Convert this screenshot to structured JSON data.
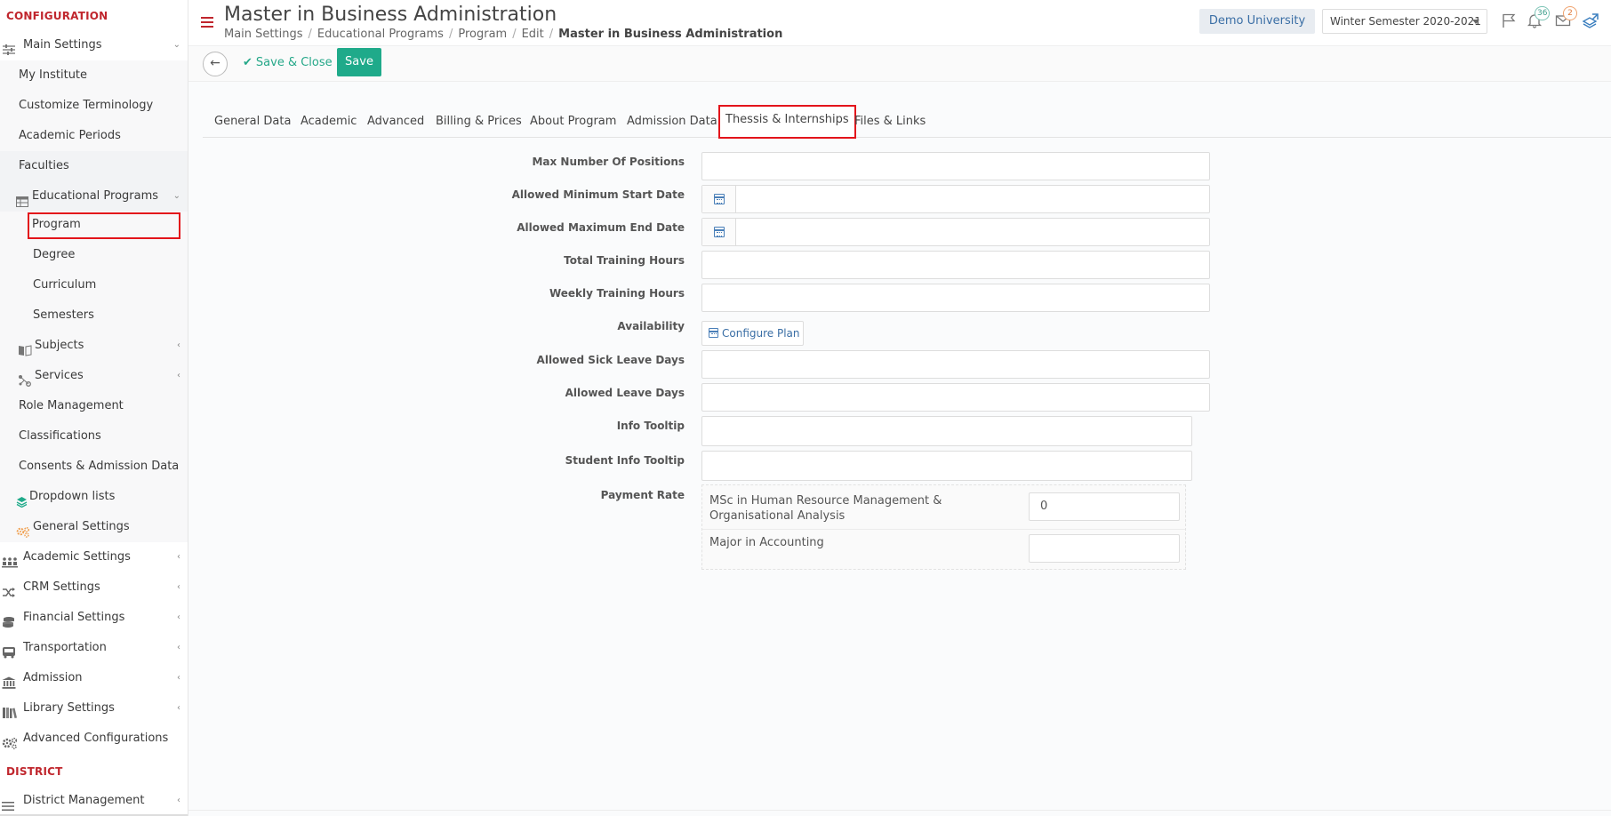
{
  "sidebar": {
    "section_configuration": "CONFIGURATION",
    "section_district": "DISTRICT",
    "items": {
      "main_settings": "Main Settings",
      "my_institute": "My Institute",
      "customize_terminology": "Customize Terminology",
      "academic_periods": "Academic Periods",
      "faculties": "Faculties",
      "educational_programs": "Educational Programs",
      "program": "Program",
      "degree": "Degree",
      "curriculum": "Curriculum",
      "semesters": "Semesters",
      "subjects": "Subjects",
      "services": "Services",
      "role_management": "Role Management",
      "classifications": "Classifications",
      "consents_admission": "Consents & Admission Data",
      "dropdown_lists": "Dropdown lists",
      "general_settings": "General Settings",
      "academic_settings": "Academic Settings",
      "crm_settings": "CRM Settings",
      "financial_settings": "Financial Settings",
      "transportation": "Transportation",
      "admission": "Admission",
      "library_settings": "Library Settings",
      "advanced_configurations": "Advanced Configurations",
      "district_management": "District Management"
    },
    "accent_color": "#c0262d"
  },
  "header": {
    "title": "Master in Business Administration",
    "breadcrumb": [
      "Main Settings",
      "Educational Programs",
      "Program",
      "Edit",
      "Master in Business Administration"
    ],
    "university": "Demo University",
    "semester": "Winter Semester 2020-2021",
    "notifications_count": "36",
    "messages_count": "2"
  },
  "toolbar": {
    "save_close_label": "Save & Close",
    "save_label": "Save"
  },
  "tabs": [
    "General Data",
    "Academic",
    "Advanced",
    "Billing & Prices",
    "About Program",
    "Admission Data",
    "Thessis & Internships",
    "Files & Links"
  ],
  "active_tab": "Thessis & Internships",
  "form": {
    "max_positions_label": "Max Number Of Positions",
    "min_start_date_label": "Allowed Minimum Start Date",
    "max_end_date_label": "Allowed Maximum End Date",
    "total_hours_label": "Total Training Hours",
    "weekly_hours_label": "Weekly Training Hours",
    "availability_label": "Availability",
    "configure_plan_label": "Configure Plan",
    "sick_leave_label": "Allowed Sick Leave Days",
    "leave_days_label": "Allowed Leave Days",
    "info_tooltip_label": "Info Tooltip",
    "student_info_tooltip_label": "Student Info Tooltip",
    "payment_rate_label": "Payment Rate",
    "payment_rates": [
      {
        "name": "MSc in Human Resource Management & Organisational Analysis",
        "value": "0"
      },
      {
        "name": "Major in Accounting",
        "value": ""
      }
    ]
  },
  "colors": {
    "primary_green": "#1faa8a",
    "link_blue": "#3a6ea5",
    "highlight_red": "#e3141b"
  }
}
